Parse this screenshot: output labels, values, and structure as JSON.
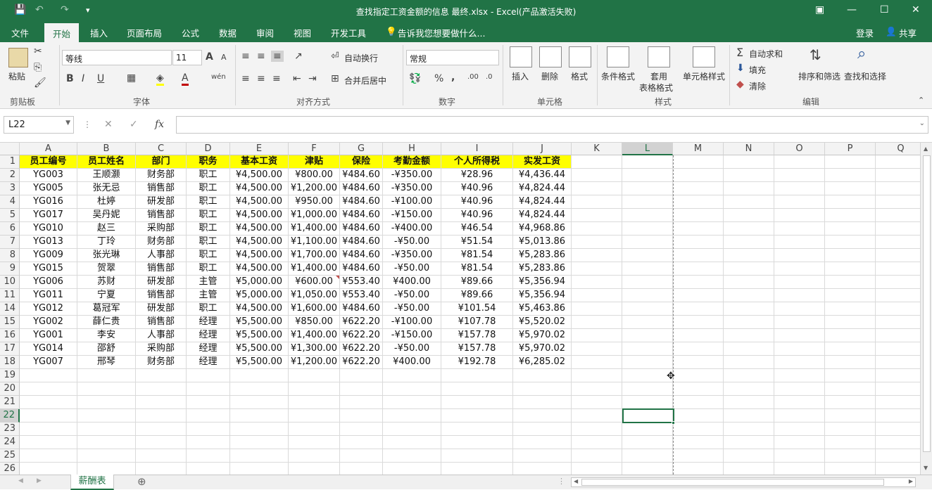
{
  "window": {
    "title": "查找指定工资金额的信息 最终.xlsx - Excel(产品激活失败)",
    "buttons": {
      "restore": "⧉",
      "minimize": "—",
      "maximize": "☐",
      "close": "✕",
      "ribbon_display": "▣"
    }
  },
  "qat": {
    "save": "💾",
    "undo": "↶",
    "redo": "↷",
    "more": "▾"
  },
  "tabs": [
    "文件",
    "开始",
    "插入",
    "页面布局",
    "公式",
    "数据",
    "审阅",
    "视图",
    "开发工具"
  ],
  "active_tab": "开始",
  "tell_me": "告诉我您想要做什么...",
  "login": "登录",
  "share": "共享",
  "ribbon": {
    "clipboard": {
      "paste": "粘贴",
      "group": "剪贴板"
    },
    "font": {
      "name": "等线",
      "size": "11",
      "group": "字体",
      "bold": "B",
      "italic": "I",
      "underline": "U",
      "grow": "A",
      "shrink": "A",
      "color": "A",
      "phonetic": "wén"
    },
    "alignment": {
      "wrap": "自动换行",
      "merge": "合并后居中",
      "group": "对齐方式"
    },
    "number": {
      "format": "常规",
      "percent": "%",
      "comma": ",",
      "group": "数字"
    },
    "cells": {
      "insert": "插入",
      "delete": "删除",
      "format": "格式",
      "group": "单元格"
    },
    "styles": {
      "conditional": "条件格式",
      "table_1": "套用",
      "table_2": "表格格式",
      "cell_styles": "单元格样式",
      "group": "样式"
    },
    "editing": {
      "autosum": "自动求和",
      "fill": "填充",
      "clear": "清除",
      "sort": "排序和筛选",
      "find": "查找和选择",
      "group": "编辑"
    }
  },
  "formula_bar": {
    "name_box": "L22",
    "fx": "fx",
    "cancel": "✕",
    "enter": "✓",
    "value": ""
  },
  "columns": [
    "A",
    "B",
    "C",
    "D",
    "E",
    "F",
    "G",
    "H",
    "I",
    "J",
    "K",
    "L",
    "M",
    "N",
    "O",
    "P",
    "Q"
  ],
  "row_numbers": [
    "1",
    "2",
    "3",
    "4",
    "5",
    "6",
    "7",
    "8",
    "9",
    "10",
    "11",
    "14",
    "15",
    "16",
    "17",
    "18",
    "19",
    "20",
    "21",
    "22",
    "23",
    "24",
    "25",
    "26"
  ],
  "headers": [
    "员工编号",
    "员工姓名",
    "部门",
    "职务",
    "基本工资",
    "津贴",
    "保险",
    "考勤金额",
    "个人所得税",
    "实发工资"
  ],
  "rows": [
    [
      "YG003",
      "王顺灏",
      "财务部",
      "职工",
      "¥4,500.00",
      "¥800.00",
      "¥484.60",
      "-¥350.00",
      "¥28.96",
      "¥4,436.44"
    ],
    [
      "YG005",
      "张无忌",
      "销售部",
      "职工",
      "¥4,500.00",
      "¥1,200.00",
      "¥484.60",
      "-¥350.00",
      "¥40.96",
      "¥4,824.44"
    ],
    [
      "YG016",
      "杜婷",
      "研发部",
      "职工",
      "¥4,500.00",
      "¥950.00",
      "¥484.60",
      "-¥100.00",
      "¥40.96",
      "¥4,824.44"
    ],
    [
      "YG017",
      "吴丹妮",
      "销售部",
      "职工",
      "¥4,500.00",
      "¥1,000.00",
      "¥484.60",
      "-¥150.00",
      "¥40.96",
      "¥4,824.44"
    ],
    [
      "YG010",
      "赵三",
      "采购部",
      "职工",
      "¥4,500.00",
      "¥1,400.00",
      "¥484.60",
      "-¥400.00",
      "¥46.54",
      "¥4,968.86"
    ],
    [
      "YG013",
      "丁玲",
      "财务部",
      "职工",
      "¥4,500.00",
      "¥1,100.00",
      "¥484.60",
      "-¥50.00",
      "¥51.54",
      "¥5,013.86"
    ],
    [
      "YG009",
      "张光琳",
      "人事部",
      "职工",
      "¥4,500.00",
      "¥1,700.00",
      "¥484.60",
      "-¥350.00",
      "¥81.54",
      "¥5,283.86"
    ],
    [
      "YG015",
      "贺翠",
      "销售部",
      "职工",
      "¥4,500.00",
      "¥1,400.00",
      "¥484.60",
      "-¥50.00",
      "¥81.54",
      "¥5,283.86"
    ],
    [
      "YG006",
      "苏财",
      "研发部",
      "主管",
      "¥5,000.00",
      "¥600.00",
      "¥553.40",
      "¥400.00",
      "¥89.66",
      "¥5,356.94"
    ],
    [
      "YG011",
      "宁夏",
      "销售部",
      "主管",
      "¥5,000.00",
      "¥1,050.00",
      "¥553.40",
      "-¥50.00",
      "¥89.66",
      "¥5,356.94"
    ],
    [
      "YG012",
      "葛冠军",
      "研发部",
      "职工",
      "¥4,500.00",
      "¥1,600.00",
      "¥484.60",
      "-¥50.00",
      "¥101.54",
      "¥5,463.86"
    ],
    [
      "YG002",
      "薛仁贵",
      "销售部",
      "经理",
      "¥5,500.00",
      "¥850.00",
      "¥622.20",
      "-¥100.00",
      "¥107.78",
      "¥5,520.02"
    ],
    [
      "YG001",
      "李安",
      "人事部",
      "经理",
      "¥5,500.00",
      "¥1,400.00",
      "¥622.20",
      "-¥150.00",
      "¥157.78",
      "¥5,970.02"
    ],
    [
      "YG014",
      "邵舒",
      "采购部",
      "经理",
      "¥5,500.00",
      "¥1,300.00",
      "¥622.20",
      "-¥50.00",
      "¥157.78",
      "¥5,970.02"
    ],
    [
      "YG007",
      "邢琴",
      "财务部",
      "经理",
      "¥5,500.00",
      "¥1,200.00",
      "¥622.20",
      "¥400.00",
      "¥192.78",
      "¥6,285.02"
    ]
  ],
  "sheet_tab": "薪酬表",
  "add_sheet": "⊕",
  "colors": {
    "green": "#217346",
    "header_fill": "#ffff00"
  }
}
